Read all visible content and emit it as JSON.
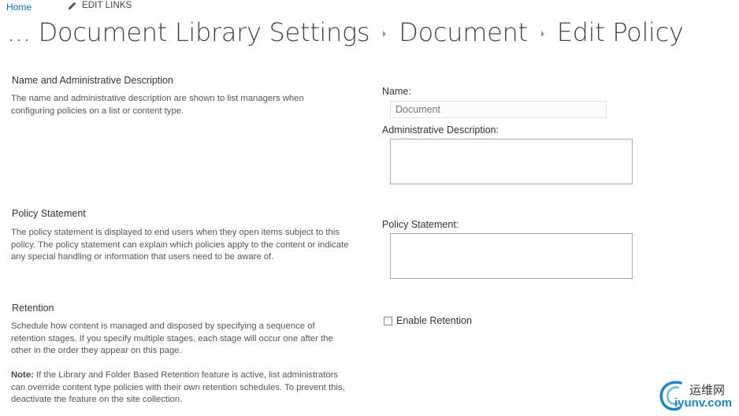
{
  "topnav": {
    "home_label": "Home",
    "edit_links_label": "EDIT LINKS"
  },
  "title": {
    "ellipsis": "...",
    "crumbs": [
      "Document Library Settings",
      "Document",
      "Edit Policy"
    ]
  },
  "sections": {
    "name": {
      "title": "Name and Administrative Description",
      "description": "The name and administrative description are shown to list managers when configuring policies on a list or content type."
    },
    "policy": {
      "title": "Policy Statement",
      "description": "The policy statement is displayed to end users when they open items subject to this policy. The policy statement can explain which policies apply to the content or indicate any special handling or information that users need to be aware of."
    },
    "retention": {
      "title": "Retention",
      "description": "Schedule how content is managed and disposed by specifying a sequence of retention stages. If you specify multiple stages, each stage will occur one after the other in the order they appear on this page.",
      "note_label": "Note:",
      "note_text": " If the Library and Folder Based Retention feature is active, list administrators can override content type policies with their own retention schedules.  To prevent this, deactivate the feature on the site collection."
    }
  },
  "form": {
    "name_label": "Name:",
    "name_value": "Document",
    "admin_desc_label": "Administrative Description:",
    "admin_desc_value": "",
    "policy_statement_label": "Policy Statement:",
    "policy_statement_value": "",
    "enable_retention_label": "Enable Retention",
    "enable_retention_checked": false
  },
  "watermark": {
    "chinese": "运维网",
    "domain": "iyunv.com"
  },
  "colors": {
    "link": "#0072c6",
    "title": "#444444",
    "watermark": "#1a86c8"
  }
}
